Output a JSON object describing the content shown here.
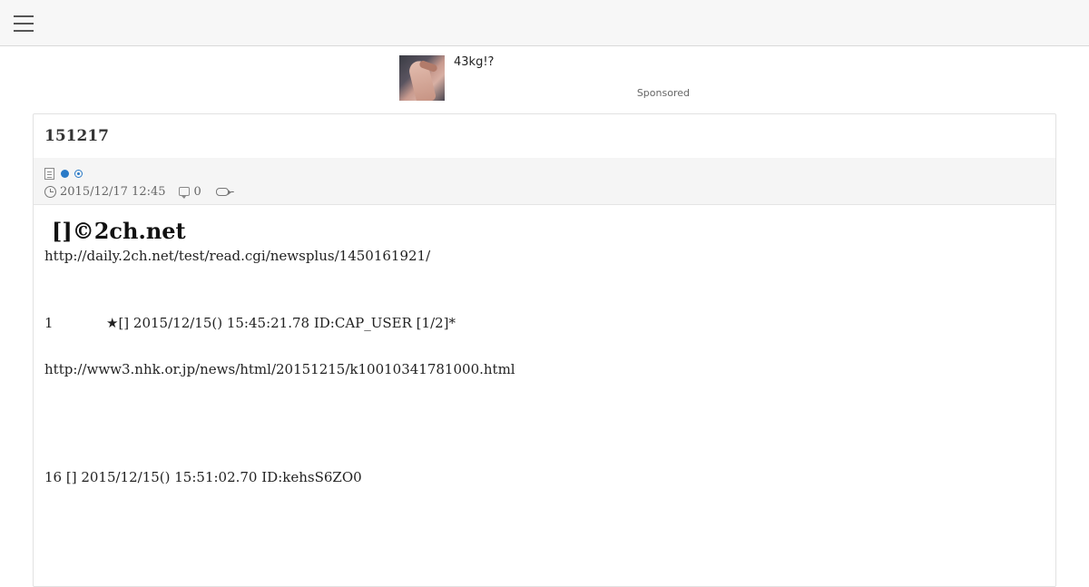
{
  "header": {
    "menu_icon": "hamburger-menu-icon"
  },
  "ad": {
    "title": "43kg!?",
    "sponsored_label": "Sponsored"
  },
  "article": {
    "title": "151217",
    "meta": {
      "icons": [
        "document-icon",
        "dot-icon",
        "ring-icon"
      ],
      "date": "2015/12/17 12:45",
      "comment_count": "0",
      "retweet_value": "-"
    },
    "heading": "[]©2ch.net",
    "lines": {
      "source_url": "http://daily.2ch.net/test/read.cgi/newsplus/1450161921/",
      "post1_number": "1",
      "post1_header": "★[] 2015/12/15() 15:45:21.78 ID:CAP_USER [1/2]*",
      "nhk_url": "http://www3.nhk.or.jp/news/html/20151215/k10010341781000.html",
      "post16_header": "16 [] 2015/12/15() 15:51:02.70 ID:kehsS6ZO0"
    }
  },
  "colors": {
    "accent": "#2a7ac7",
    "topbar_bg": "#f7f7f7",
    "meta_bg": "#f5f5f5"
  }
}
